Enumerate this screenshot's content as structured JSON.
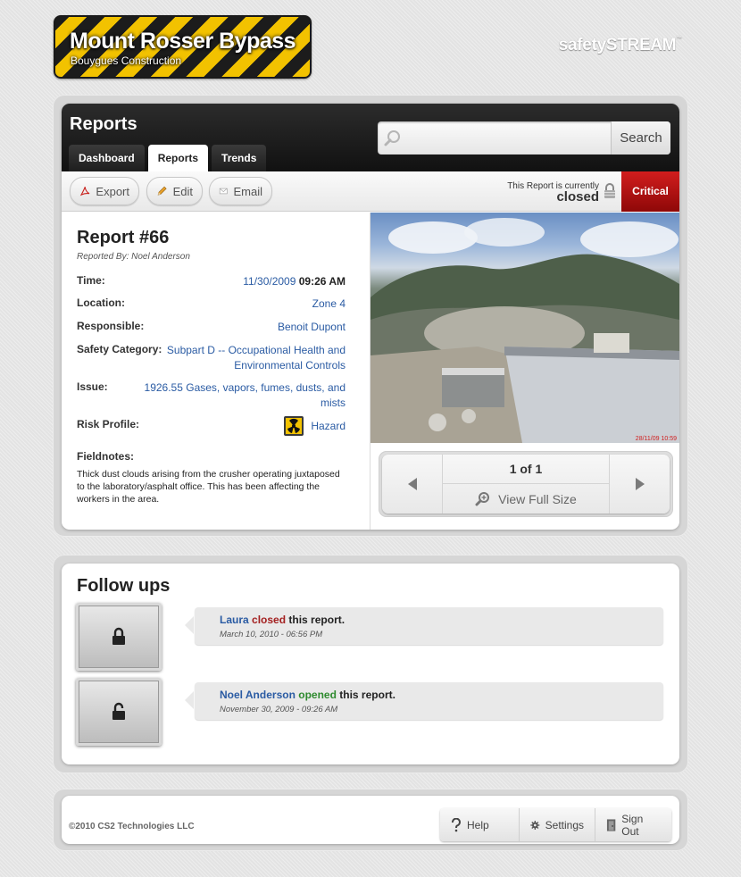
{
  "project": {
    "title": "Mount Rosser Bypass",
    "subtitle": "Bouygues Construction"
  },
  "app_logo": "safetySTREAM",
  "app_logo_tm": "™",
  "page": {
    "title": "Reports"
  },
  "tabs": [
    {
      "label": "Dashboard",
      "active": false
    },
    {
      "label": "Reports",
      "active": true
    },
    {
      "label": "Trends",
      "active": false
    }
  ],
  "search": {
    "value": "",
    "button": "Search"
  },
  "toolbar": {
    "export": "Export",
    "edit": "Edit",
    "email": "Email",
    "status_prefix": "This Report is currently",
    "status": "closed",
    "severity": "Critical"
  },
  "report": {
    "title": "Report #66",
    "reported_by": "Reported By: Noel Anderson",
    "fields": {
      "time_label": "Time:",
      "date": "11/30/2009",
      "time": "09:26 AM",
      "location_label": "Location:",
      "location": "Zone 4",
      "responsible_label": "Responsible:",
      "responsible": "Benoit Dupont",
      "category_label": "Safety Category:",
      "category": "Subpart D -- Occupational Health and Environmental Controls",
      "issue_label": "Issue:",
      "issue": "1926.55 Gases, vapors, fumes, dusts, and mists",
      "risk_label": "Risk Profile:",
      "risk": "Hazard"
    },
    "fieldnotes_label": "Fieldnotes:",
    "fieldnotes": "Thick dust clouds arising from the crusher operating juxtaposed to the laboratory/asphalt office. This has been affecting the workers in the area."
  },
  "photo": {
    "timestamp": "28/11/09 10:59"
  },
  "pager": {
    "count": "1 of 1",
    "view_full": "View Full Size"
  },
  "followups": {
    "title": "Follow ups",
    "items": [
      {
        "name": "Laura",
        "action": "closed",
        "suffix": "this report.",
        "date": "March 10, 2010 - 06:56 PM"
      },
      {
        "name": "Noel Anderson",
        "action": "opened",
        "suffix": "this report.",
        "date": "November 30, 2009 - 09:26 AM"
      }
    ]
  },
  "footer": {
    "copyright": "©2010 CS2 Technologies LLC",
    "help": "Help",
    "settings": "Settings",
    "signout": "Sign Out"
  },
  "colors": {
    "link": "#2a5ba3",
    "critical": "#b31010",
    "stripe_yellow": "#f2c200",
    "stripe_black": "#1c1c1c"
  }
}
